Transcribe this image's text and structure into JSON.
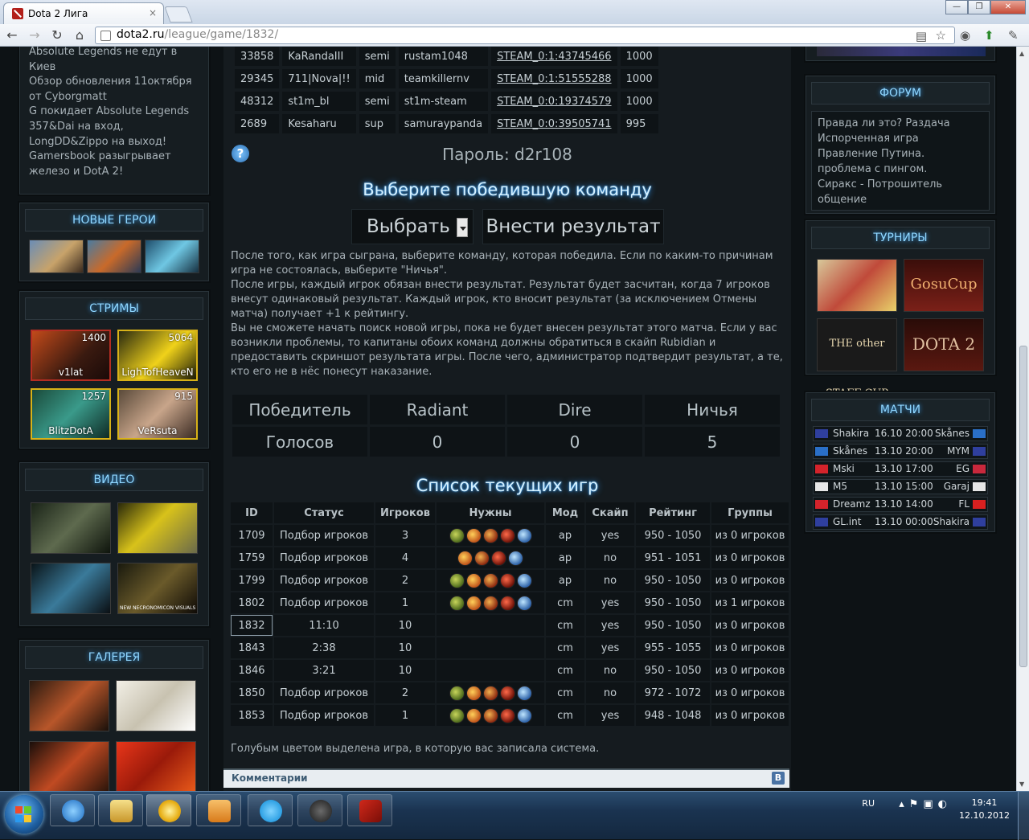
{
  "browser": {
    "tab_title": "Dota 2 Лига",
    "tab_close": "×",
    "url_host": "dota2.ru",
    "url_path": "/league/game/1832/",
    "back": "←",
    "forward": "→",
    "reload": "↻",
    "home": "⌂",
    "win_min": "—",
    "win_max": "❐",
    "win_close": "✕"
  },
  "left": {
    "news": [
      "Absolute Legends не едут в Киев",
      "Обзор обновления 11октября от Cyborgmatt",
      "G покидает Absolute Legends",
      "357&Dai на вход, LongDD&Zippo на выход!",
      "Gamersbook разыгрывает железо и DotA 2!"
    ],
    "heroes_title": "НОВЫЕ ГЕРОИ",
    "streams_title": "СТРИМЫ",
    "streams": [
      {
        "name": "v1lat",
        "viewers": "1400"
      },
      {
        "name": "LighTofHeaveN",
        "viewers": "5064"
      },
      {
        "name": "BlitzDotA",
        "viewers": "1257"
      },
      {
        "name": "VeRsuta",
        "viewers": "915"
      }
    ],
    "video_title": "ВИДЕО",
    "video_caption": "NEW NECRONOMICON VISUALS",
    "gallery_title": "ГАЛЕРЕЯ"
  },
  "right": {
    "forum_title": "ФОРУМ",
    "forum": [
      "Правда ли это? Раздача",
      "Испорченная игра",
      "Правление Путина.",
      "проблема с пингом.",
      "Сиракс - Потрошитель",
      "общение"
    ],
    "tournaments_title": "ТУРНИРЫ",
    "tournaments": [
      "",
      "GosuCup",
      "THE other STAFF CUP",
      "DOTA 2"
    ],
    "matches_title": "МАТЧИ",
    "matches": [
      {
        "t1": "Shakira",
        "time": "16.10 20:00",
        "t2": "Skånes",
        "f1": "#2f3f9e",
        "f2": "#2a6fc7"
      },
      {
        "t1": "Skånes",
        "time": "13.10 20:00",
        "t2": "MYM",
        "f1": "#2a6fc7",
        "f2": "#2f3f9e"
      },
      {
        "t1": "Mski",
        "time": "13.10 17:00",
        "t2": "EG",
        "f1": "#d4232b",
        "f2": "#c8283c"
      },
      {
        "t1": "M5",
        "time": "13.10 15:00",
        "t2": "Garaj",
        "f1": "#e6e6e6",
        "f2": "#e6e6e6"
      },
      {
        "t1": "Dreamz",
        "time": "13.10 14:00",
        "t2": "FL",
        "f1": "#d4232b",
        "f2": "#d92020"
      },
      {
        "t1": "GL.int",
        "time": "13.10 00:00",
        "t2": "Shakira",
        "f1": "#2f3f9e",
        "f2": "#2f3f9e"
      }
    ]
  },
  "players": [
    {
      "rating": "33858",
      "nick": "KaRandaIII",
      "role": "semi",
      "skype": "rustam1048",
      "steam": "STEAM_0:1:43745466",
      "score": "1000"
    },
    {
      "rating": "29345",
      "nick": "711|Nova|!!",
      "role": "mid",
      "skype": "teamkillernv",
      "steam": "STEAM_0:1:51555288",
      "score": "1000"
    },
    {
      "rating": "48312",
      "nick": "st1m_bl",
      "role": "semi",
      "skype": "st1m-steam",
      "steam": "STEAM_0:0:19374579",
      "score": "1000"
    },
    {
      "rating": "2689",
      "nick": "Kesaharu",
      "role": "sup",
      "skype": "samuraypanda",
      "steam": "STEAM_0:0:39505741",
      "score": "995"
    }
  ],
  "game": {
    "help": "?",
    "password": "Пароль: d2r108",
    "choose_title": "Выберите победившую команду",
    "select_label": "Выбрать",
    "submit_label": "Внести результат",
    "info": [
      "После того, как игра сыграна, выберите команду, которая победила. Если по каким-то причинам игра не состоялась, выберите \"Ничья\".",
      "После игры, каждый игрок обязан внести результат. Результат будет засчитан, когда 7 игроков внесут одинаковый результат. Каждый игрок, кто вносит результат (за исключением Отмены матча) получает +1 к рейтингу.",
      "Вы не сможете начать поиск новой игры, пока не будет внесен результат этого матча. Если у вас возникли проблемы, то капитаны обоих команд должны обратиться в скайп Rubidian и предоставить скриншот результата игры. После чего, администратор подтвердит результат, а те, кто его не в нёс понесут наказание."
    ],
    "results": {
      "header": [
        "Победитель",
        "Radiant",
        "Dire",
        "Ничья"
      ],
      "votes_label": "Голосов",
      "votes": [
        "0",
        "0",
        "5"
      ]
    }
  },
  "games_list": {
    "title": "Список текущих игр",
    "columns": [
      "ID",
      "Статус",
      "Игроков",
      "Нужны",
      "Мод",
      "Скайп",
      "Рейтинг",
      "Группы"
    ],
    "rows": [
      {
        "id": "1709",
        "status": "Подбор игроков",
        "players": "3",
        "icons": 5,
        "mod": "ap",
        "skype": "yes",
        "rating": "950 - 1050",
        "groups": "из 0 игроков"
      },
      {
        "id": "1759",
        "status": "Подбор игроков",
        "players": "4",
        "icons": 4,
        "mod": "ap",
        "skype": "no",
        "rating": "951 - 1051",
        "groups": "из 0 игроков"
      },
      {
        "id": "1799",
        "status": "Подбор игроков",
        "players": "2",
        "icons": 5,
        "mod": "ap",
        "skype": "no",
        "rating": "950 - 1050",
        "groups": "из 0 игроков"
      },
      {
        "id": "1802",
        "status": "Подбор игроков",
        "players": "1",
        "icons": 5,
        "mod": "cm",
        "skype": "yes",
        "rating": "950 - 1050",
        "groups": "из 1 игроков"
      },
      {
        "id": "1832",
        "status": "11:10",
        "players": "10",
        "icons": 0,
        "mod": "cm",
        "skype": "yes",
        "rating": "950 - 1050",
        "groups": "из 0 игроков"
      },
      {
        "id": "1843",
        "status": "2:38",
        "players": "10",
        "icons": 0,
        "mod": "cm",
        "skype": "yes",
        "rating": "955 - 1055",
        "groups": "из 0 игроков"
      },
      {
        "id": "1846",
        "status": "3:21",
        "players": "10",
        "icons": 0,
        "mod": "cm",
        "skype": "no",
        "rating": "950 - 1050",
        "groups": "из 0 игроков"
      },
      {
        "id": "1850",
        "status": "Подбор игроков",
        "players": "2",
        "icons": 5,
        "mod": "cm",
        "skype": "no",
        "rating": "972 - 1072",
        "groups": "из 0 игроков"
      },
      {
        "id": "1853",
        "status": "Подбор игроков",
        "players": "1",
        "icons": 5,
        "mod": "cm",
        "skype": "yes",
        "rating": "948 - 1048",
        "groups": "из 0 игроков"
      }
    ],
    "note": "Голубым цветом выделена игра, в которую вас записала система."
  },
  "comments": {
    "title": "Комментарии",
    "vk": "В"
  },
  "taskbar": {
    "lang": "RU",
    "time": "19:41",
    "date": "12.10.2012"
  }
}
